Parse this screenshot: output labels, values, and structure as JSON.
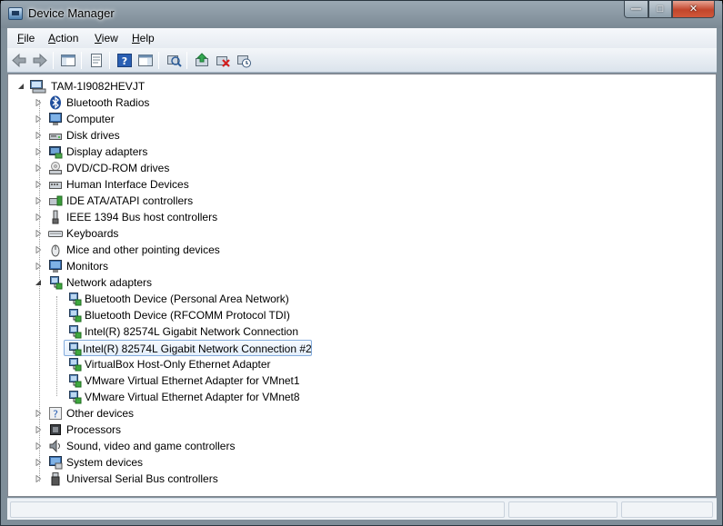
{
  "window": {
    "title": "Device Manager"
  },
  "caption_buttons": {
    "minimize": "—",
    "maximize": "□",
    "close": "✕"
  },
  "menu": [
    {
      "underline": "F",
      "rest": "ile"
    },
    {
      "underline": "A",
      "rest": "ction"
    },
    {
      "underline": "V",
      "rest": "iew"
    },
    {
      "underline": "H",
      "rest": "elp"
    }
  ],
  "toolbar": [
    "back-icon",
    "forward-icon",
    "show-hide-console-tree-icon",
    "properties-icon",
    "help-icon",
    "action-pane-icon",
    "scan-hardware-icon",
    "update-driver-icon",
    "uninstall-icon",
    "disable-icon"
  ],
  "tree": {
    "root": "TAM-1I9082HEVJT",
    "categories": [
      {
        "label": "Bluetooth Radios",
        "icon": "bluetooth-icon"
      },
      {
        "label": "Computer",
        "icon": "computer-icon"
      },
      {
        "label": "Disk drives",
        "icon": "disk-drive-icon"
      },
      {
        "label": "Display adapters",
        "icon": "display-adapter-icon"
      },
      {
        "label": "DVD/CD-ROM drives",
        "icon": "dvd-drive-icon"
      },
      {
        "label": "Human Interface Devices",
        "icon": "hid-icon"
      },
      {
        "label": "IDE ATA/ATAPI controllers",
        "icon": "ide-controller-icon"
      },
      {
        "label": "IEEE 1394 Bus host controllers",
        "icon": "firewire-icon"
      },
      {
        "label": "Keyboards",
        "icon": "keyboard-icon"
      },
      {
        "label": "Mice and other pointing devices",
        "icon": "mouse-icon"
      },
      {
        "label": "Monitors",
        "icon": "monitor-icon"
      },
      {
        "label": "Network adapters",
        "icon": "network-adapter-icon",
        "expanded": true
      },
      {
        "label": "Other devices",
        "icon": "other-devices-icon"
      },
      {
        "label": "Processors",
        "icon": "processor-icon"
      },
      {
        "label": "Sound, video and game controllers",
        "icon": "sound-icon"
      },
      {
        "label": "System devices",
        "icon": "system-devices-icon"
      },
      {
        "label": "Universal Serial Bus controllers",
        "icon": "usb-icon"
      }
    ],
    "network_children": [
      "Bluetooth Device (Personal Area Network)",
      "Bluetooth Device (RFCOMM Protocol TDI)",
      "Intel(R) 82574L Gigabit Network Connection",
      "Intel(R) 82574L Gigabit Network Connection #2",
      "VirtualBox Host-Only Ethernet Adapter",
      "VMware Virtual Ethernet Adapter for VMnet1",
      "VMware Virtual Ethernet Adapter for VMnet8"
    ],
    "selected_child_index": 3
  }
}
